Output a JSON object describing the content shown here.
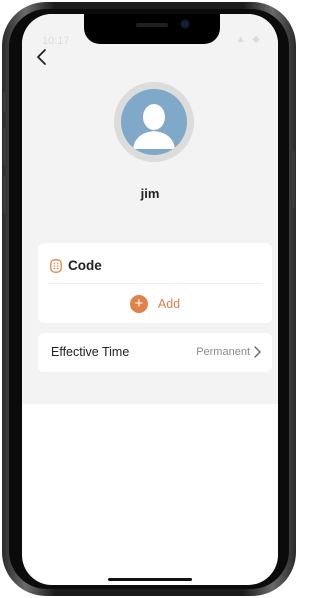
{
  "status_bar": {
    "time": "10:17",
    "icons": "▲ ◆"
  },
  "nav": {
    "back_icon": "chevron-left-icon"
  },
  "profile": {
    "avatar_icon": "user-avatar-icon",
    "name": "jim"
  },
  "code_section": {
    "icon": "code-keypad-icon",
    "title": "Code",
    "add_icon": "plus-icon",
    "add_label": "Add"
  },
  "effective_time": {
    "label": "Effective Time",
    "value": "Permanent",
    "chevron_icon": "chevron-right-icon"
  },
  "colors": {
    "accent": "#e0824a",
    "background": "#f3f3f3",
    "avatar_bg": "#7fa8c9"
  }
}
